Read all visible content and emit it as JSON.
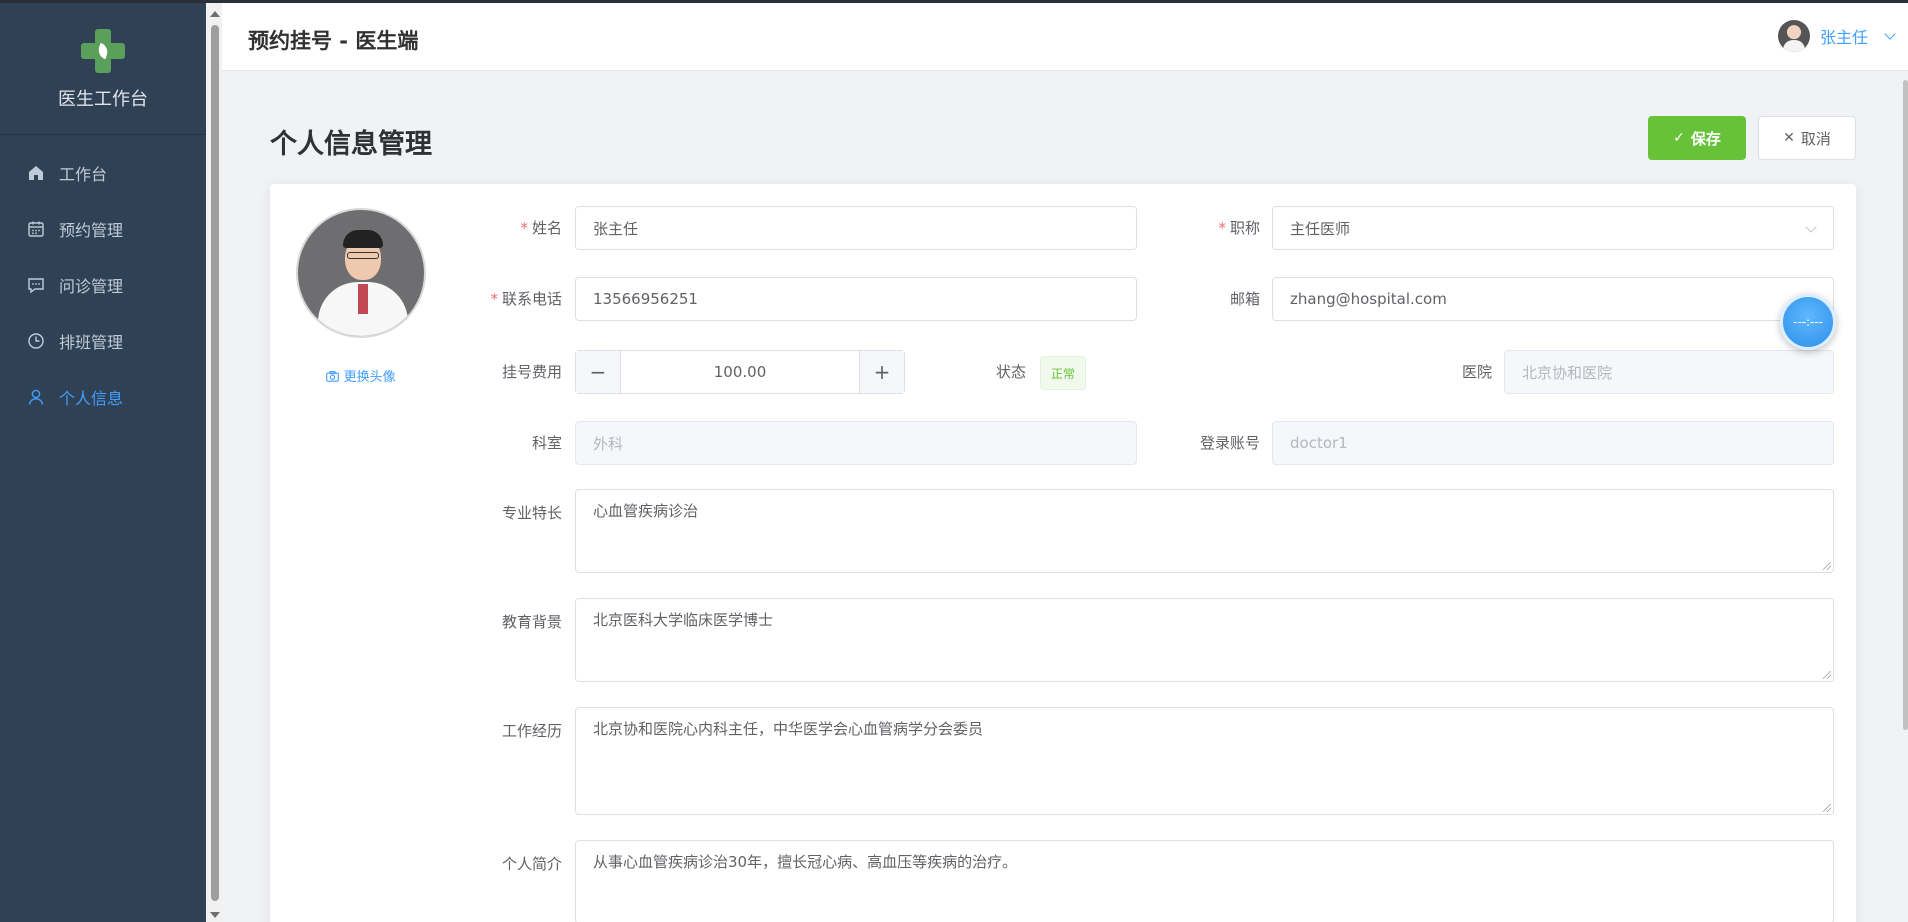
{
  "sidebar": {
    "brand_title": "医生工作台",
    "items": [
      {
        "label": "工作台",
        "icon": "home-icon"
      },
      {
        "label": "预约管理",
        "icon": "calendar-icon"
      },
      {
        "label": "问诊管理",
        "icon": "chat-icon"
      },
      {
        "label": "排班管理",
        "icon": "clock-icon"
      },
      {
        "label": "个人信息",
        "icon": "user-icon",
        "active": true
      }
    ]
  },
  "header": {
    "title": "预约挂号 - 医生端",
    "user_name": "张主任"
  },
  "page": {
    "title": "个人信息管理",
    "save_label": "保存",
    "cancel_label": "取消"
  },
  "profile": {
    "change_avatar_label": "更换头像",
    "fields": {
      "name": {
        "label": "姓名",
        "value": "张主任",
        "required": true
      },
      "title": {
        "label": "职称",
        "value": "主任医师",
        "required": true
      },
      "phone": {
        "label": "联系电话",
        "value": "13566956251",
        "required": true
      },
      "email": {
        "label": "邮箱",
        "value": "zhang@hospital.com"
      },
      "fee": {
        "label": "挂号费用",
        "value": "100.00"
      },
      "status": {
        "label": "状态",
        "value": "正常"
      },
      "hospital": {
        "label": "医院",
        "value": "北京协和医院"
      },
      "department": {
        "label": "科室",
        "value": "外科"
      },
      "account": {
        "label": "登录账号",
        "value": "doctor1"
      },
      "specialty": {
        "label": "专业特长",
        "value": "心血管疾病诊治"
      },
      "education": {
        "label": "教育背景",
        "value": "北京医科大学临床医学博士"
      },
      "experience": {
        "label": "工作经历",
        "value": "北京协和医院心内科主任，中华医学会心血管病学分会委员"
      },
      "bio": {
        "label": "个人简介",
        "value": "从事心血管疾病诊治30年，擅长冠心病、高血压等疾病的治疗。"
      }
    }
  },
  "float_button": {
    "label": "---:---"
  },
  "colors": {
    "sidebar_bg": "#304156",
    "accent": "#409eff",
    "success": "#67c23a",
    "required": "#f56c6c"
  }
}
